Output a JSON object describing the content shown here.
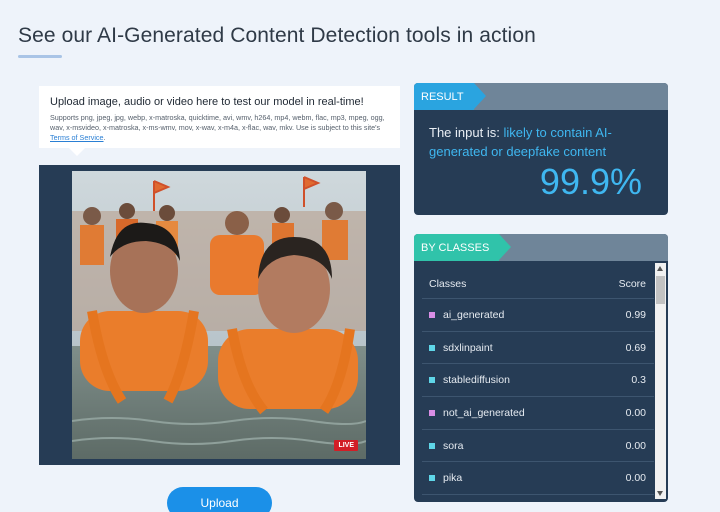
{
  "page": {
    "title": "See our AI-Generated Content Detection tools in action"
  },
  "upload": {
    "heading": "Upload image, audio or video here to test our model in real-time!",
    "formats_text": "Supports png, jpeg, jpg, webp, x-matroska, quicktime, avi, wmv, h264, mp4, webm, flac, mp3, mpeg, ogg, wav, x-msvideo, x-matroska, x-ms-wmv, mov, x-wav, x-m4a, x-flac, wav, mkv. Use is subject to this site's ",
    "tos_link": "Terms of Service",
    "tos_suffix": ".",
    "button_label": "Upload",
    "live_badge": "LIVE"
  },
  "result": {
    "tag": "RESULT",
    "prefix": "The input is: ",
    "verdict": "likely to contain AI-generated or deepfake content",
    "score": "99.9%"
  },
  "classes": {
    "tag": "BY CLASSES",
    "col_class": "Classes",
    "col_score": "Score",
    "rows": [
      {
        "name": "ai_generated",
        "score": "0.99",
        "color": "#d98ee6"
      },
      {
        "name": "sdxlinpaint",
        "score": "0.69",
        "color": "#5fd6e8"
      },
      {
        "name": "stablediffusion",
        "score": "0.3",
        "color": "#5fd6e8"
      },
      {
        "name": "not_ai_generated",
        "score": "0.00",
        "color": "#d98ee6"
      },
      {
        "name": "sora",
        "score": "0.00",
        "color": "#5fd6e8"
      },
      {
        "name": "pika",
        "score": "0.00",
        "color": "#5fd6e8"
      }
    ]
  }
}
